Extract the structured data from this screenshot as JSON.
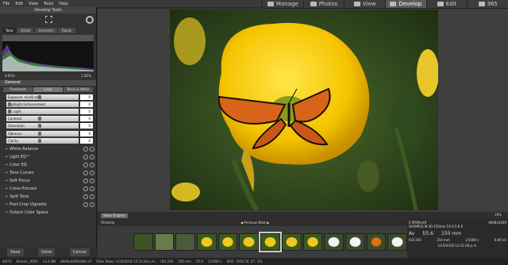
{
  "menu": [
    "File",
    "Edit",
    "View",
    "Tools",
    "Help"
  ],
  "modes": [
    {
      "label": "Manage",
      "icon": "manage-icon"
    },
    {
      "label": "Photos",
      "icon": "photos-icon"
    },
    {
      "label": "View",
      "icon": "view-icon"
    },
    {
      "label": "Develop",
      "icon": "develop-icon",
      "active": true
    },
    {
      "label": "Edit",
      "icon": "edit-icon"
    },
    {
      "label": "365",
      "icon": "cloud-icon"
    }
  ],
  "panel": {
    "title": "Develop Tools",
    "tabs": [
      "Tune",
      "Detail",
      "Geometry",
      "Repair"
    ],
    "histogram": {
      "left": "8.65%",
      "right": "1.82%"
    },
    "general": "General",
    "subtabs": [
      "Treatment",
      "Color",
      "Black & White"
    ],
    "sliders": [
      {
        "label": "Exposure +0.00 eV",
        "value": "0"
      },
      {
        "label": "Highlight Enhancement",
        "value": "0"
      },
      {
        "label": "Fill Light",
        "value": "0"
      },
      {
        "label": "Contrast",
        "value": "0"
      },
      {
        "label": "Saturation",
        "value": "0"
      },
      {
        "label": "Vibrance",
        "value": "0"
      },
      {
        "label": "Clarity",
        "value": "0"
      }
    ],
    "sections": [
      "White Balance",
      "Light EQ™",
      "Color EQ",
      "Tone Curves",
      "Soft Focus",
      "Cross Process",
      "Split Tone",
      "Post-Crop Vignette",
      "Output Color Space"
    ],
    "buttons": [
      "Save",
      "Done",
      "Cancel"
    ]
  },
  "viewer": {
    "show_original": "Show Original",
    "zoom": "18%"
  },
  "filmstrip": {
    "label": "Filmstrip",
    "prev": "Previous",
    "next": "Next"
  },
  "info": {
    "file": "E-M5MarkII",
    "lens": "OLYMPUS M.40-150mm F4.0-5.6 R",
    "dims": "4608x3456",
    "mode": "Av",
    "iso": "ISO 200",
    "focal": "150 mm",
    "shutter": "1/1000 s",
    "ev": "0.00 eV",
    "fnum": "f/5.6",
    "mm": "150 mm",
    "date": "1/10/2016 12:21:28 p.m."
  },
  "status": [
    "49/73",
    "Botanic_0050",
    "13.4 MB",
    "4608x3456x8bit srf",
    "Date Taken: 1/10/2016 12:21:28 p.m.",
    "ISO 200",
    "150 mm",
    "f/5.6",
    "1/1000 s",
    "(835 : RGB 50, 47, 33)"
  ]
}
